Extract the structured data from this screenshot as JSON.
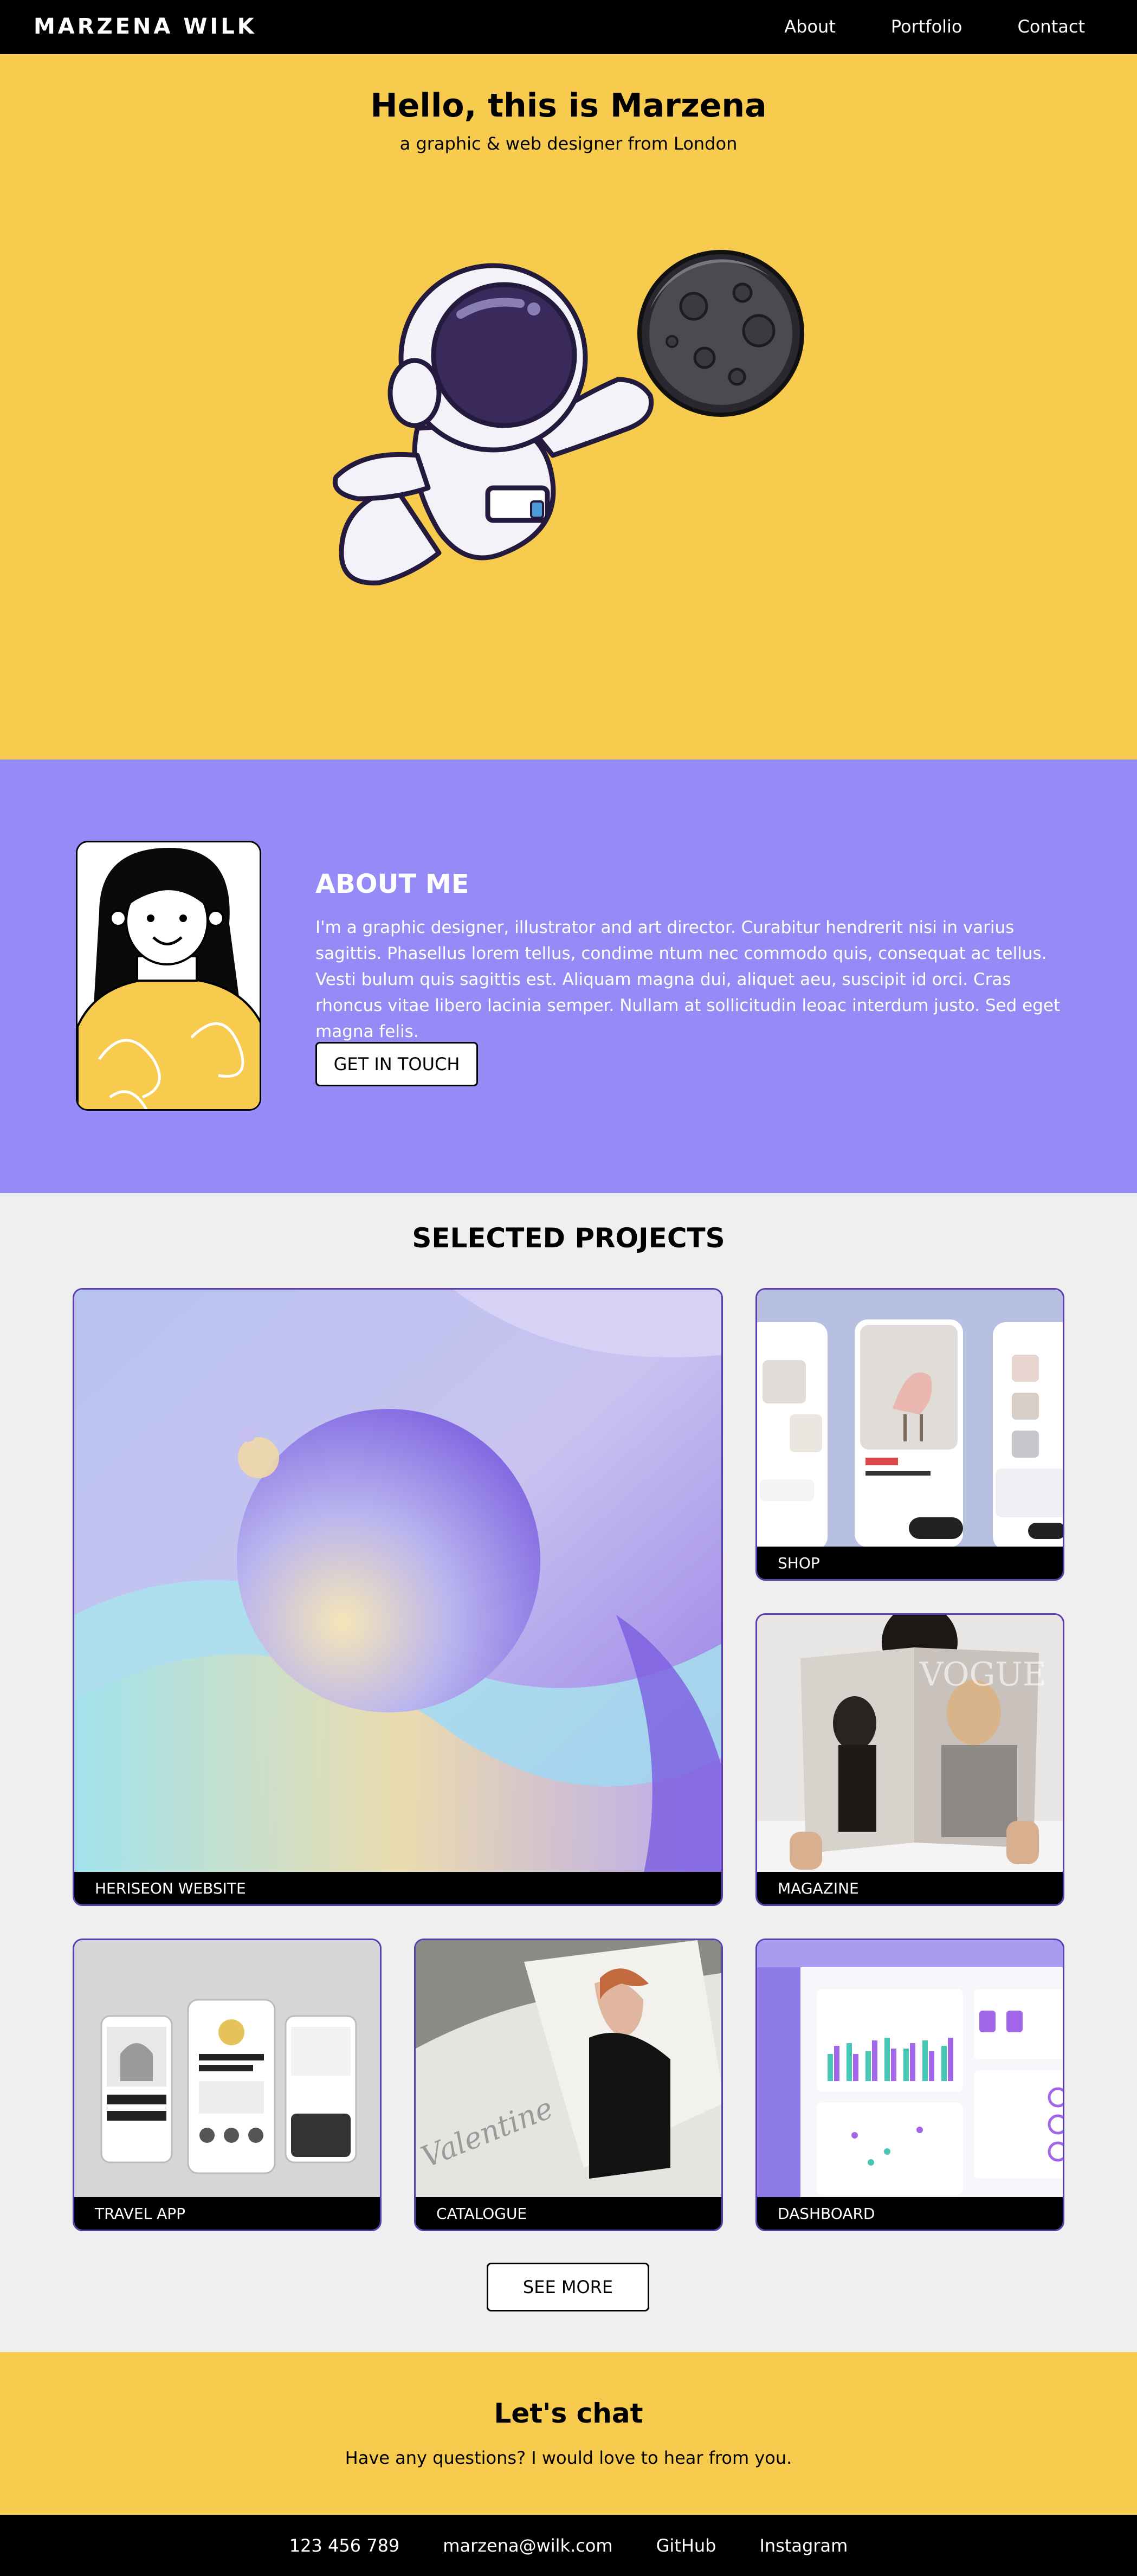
{
  "nav": {
    "brand": "MARZENA WILK",
    "links": [
      "About",
      "Portfolio",
      "Contact"
    ]
  },
  "hero": {
    "title": "Hello, this is Marzena",
    "subtitle": "a graphic & web designer from London"
  },
  "about": {
    "heading": "ABOUT ME",
    "bio": "I'm a graphic designer, illustrator and art director. Curabitur hendrerit nisi in varius sagittis. Phasellus lorem tellus, condime ntum nec commodo quis, consequat ac tellus. Vesti bulum quis sagittis est. Aliquam magna dui, aliquet aeu, suscipit id orci. Cras rhoncus vitae libero lacinia semper. Nullam at sollicitudin leoac interdum justo. Sed eget magna felis.",
    "cta": "GET IN TOUCH"
  },
  "projects": {
    "heading": "SELECTED PROJECTS",
    "items": [
      {
        "label": "HERISEON WEBSITE"
      },
      {
        "label": "SHOP"
      },
      {
        "label": "MAGAZINE"
      },
      {
        "label": "TRAVEL APP"
      },
      {
        "label": "CATALOGUE"
      },
      {
        "label": "DASHBOARD"
      }
    ],
    "more": "SEE MORE"
  },
  "chat": {
    "heading": "Let's chat",
    "text": "Have any questions? I would love to hear from you."
  },
  "footer": {
    "links": [
      "123 456 789",
      "marzena@wilk.com",
      "GitHub",
      "Instagram"
    ]
  },
  "colors": {
    "yellow": "#f7cb4d",
    "purple": "#968af7",
    "black": "#000000",
    "light_gray": "#efefef"
  }
}
